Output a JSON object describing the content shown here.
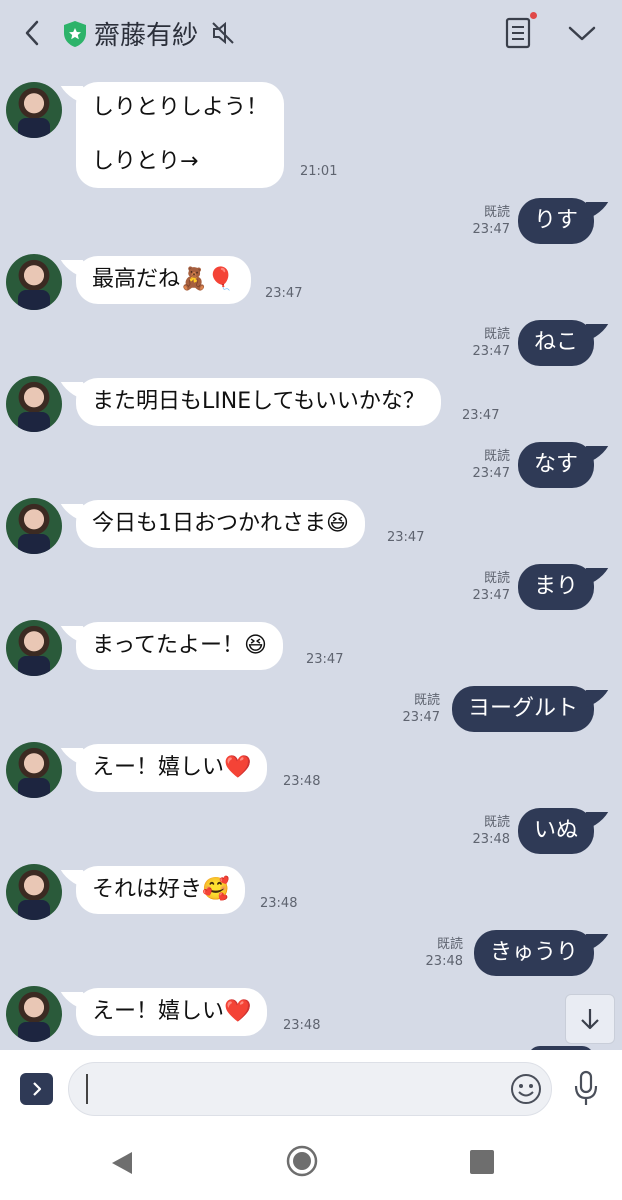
{
  "header": {
    "title": "齋藤有紗"
  },
  "colors": {
    "background": "#d5dae6",
    "outgoing_bubble": "#2f3a56",
    "incoming_bubble": "#ffffff",
    "shield": "#2db36a",
    "unread_dot": "#e04848"
  },
  "icons": [
    "back-icon",
    "shield-star-icon",
    "mute-icon",
    "notes-icon",
    "chevron-down-icon",
    "scroll-down-icon",
    "expand-icon",
    "emoji-icon",
    "mic-icon",
    "nav-back-icon",
    "nav-home-icon",
    "nav-recent-icon"
  ],
  "messages": [
    {
      "dir": "in",
      "lines": [
        "しりとりしよう！",
        "しりとり→"
      ],
      "time": "21:01"
    },
    {
      "dir": "out",
      "text": "りす",
      "read": "既読",
      "time": "23:47"
    },
    {
      "dir": "in",
      "text": "最高だね🧸🎈",
      "time": "23:47"
    },
    {
      "dir": "out",
      "text": "ねこ",
      "read": "既読",
      "time": "23:47"
    },
    {
      "dir": "in",
      "text": "また明日もLINEしてもいいかな？",
      "time": "23:47"
    },
    {
      "dir": "out",
      "text": "なす",
      "read": "既読",
      "time": "23:47"
    },
    {
      "dir": "in",
      "text": "今日も1日おつかれさま😆",
      "time": "23:47"
    },
    {
      "dir": "out",
      "text": "まり",
      "read": "既読",
      "time": "23:47"
    },
    {
      "dir": "in",
      "text": "まってたよー！😆",
      "time": "23:47"
    },
    {
      "dir": "out",
      "text": "ヨーグルト",
      "read": "既読",
      "time": "23:47"
    },
    {
      "dir": "in",
      "text": "えー！嬉しい❤️",
      "time": "23:48"
    },
    {
      "dir": "out",
      "text": "いぬ",
      "read": "既読",
      "time": "23:48"
    },
    {
      "dir": "in",
      "text": "それは好き🥰",
      "time": "23:48"
    },
    {
      "dir": "out",
      "text": "きゅうり",
      "read": "既読",
      "time": "23:48"
    },
    {
      "dir": "in",
      "text": "えー！嬉しい❤️",
      "time": "23:48"
    }
  ],
  "input": {
    "value": ""
  }
}
